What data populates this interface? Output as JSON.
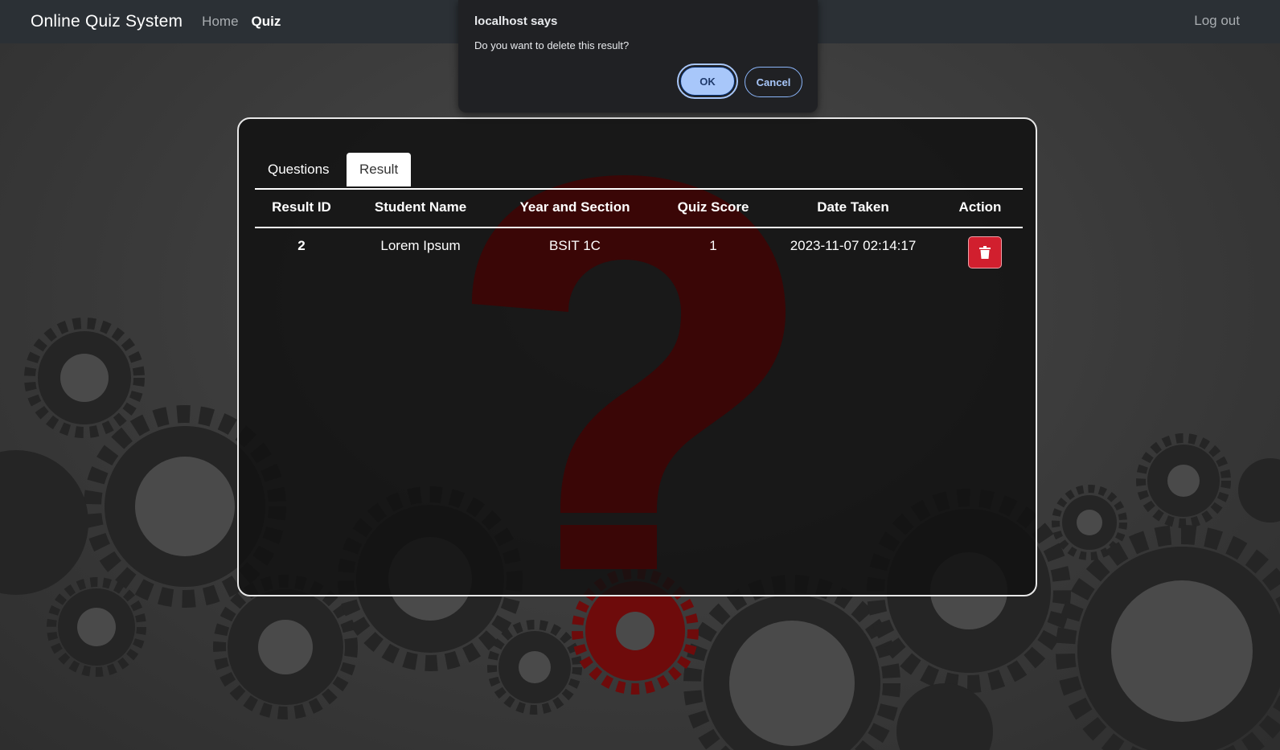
{
  "navbar": {
    "brand": "Online Quiz System",
    "home": "Home",
    "quiz": "Quiz",
    "logout": "Log out"
  },
  "tabs": [
    {
      "label": "Questions",
      "active": false
    },
    {
      "label": "Result",
      "active": true
    }
  ],
  "table": {
    "headers": [
      "Result ID",
      "Student Name",
      "Year and Section",
      "Quiz Score",
      "Date Taken",
      "Action"
    ],
    "rows": [
      {
        "result_id": "2",
        "student_name": "Lorem Ipsum",
        "year_section": "BSIT 1C",
        "quiz_score": "1",
        "date_taken": "2023-11-07 02:14:17",
        "action_icon": "trash-icon"
      }
    ]
  },
  "dialog": {
    "title": "localhost says",
    "message": "Do you want to delete this result?",
    "ok": "OK",
    "cancel": "Cancel"
  },
  "colors": {
    "navbar": "#2b3035",
    "delete_button": "#d11f2e",
    "dialog_bg": "#202124",
    "ok_button": "#a8c7fa"
  }
}
